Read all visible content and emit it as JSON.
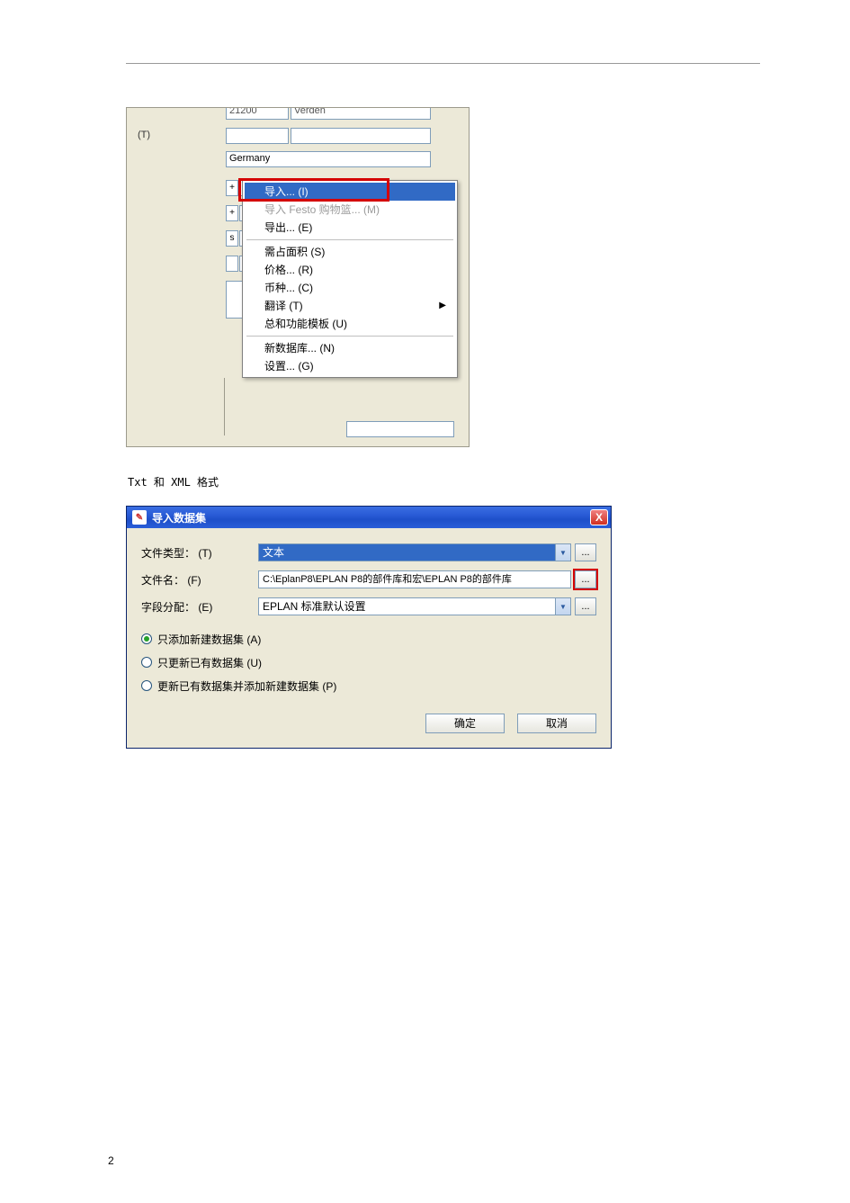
{
  "page_number": "2",
  "screenshot1": {
    "row0_a": "21200",
    "row0_b": "Verden",
    "label_t": "(T)",
    "country": "Germany",
    "stub_plus": "+",
    "stub_s": "s",
    "menu": {
      "import": "导入... (I)",
      "import_festo": "导入 Festo 购物篮... (M)",
      "export": "导出... (E)",
      "area": "需占面积 (S)",
      "price": "价格... (R)",
      "currency": "币种... (C)",
      "translate": "翻译 (T)",
      "template": "总和功能模板 (U)",
      "newdb": "新数据库... (N)",
      "settings": "设置... (G)"
    }
  },
  "caption": "Txt 和 XML 格式",
  "dialog": {
    "title": "导入数据集",
    "close": "X",
    "row_type_label": "文件类型： (T)",
    "row_type_value": "文本",
    "row_name_label": "文件名： (F)",
    "row_name_value": "C:\\EplanP8\\EPLAN P8的部件库和宏\\EPLAN P8的部件库",
    "row_field_label": "字段分配： (E)",
    "row_field_value": "EPLAN 标准默认设置",
    "dot": "...",
    "radio1": "只添加新建数据集 (A)",
    "radio2": "只更新已有数据集 (U)",
    "radio3": "更新已有数据集并添加新建数据集 (P)",
    "ok": "确定",
    "cancel": "取消"
  }
}
